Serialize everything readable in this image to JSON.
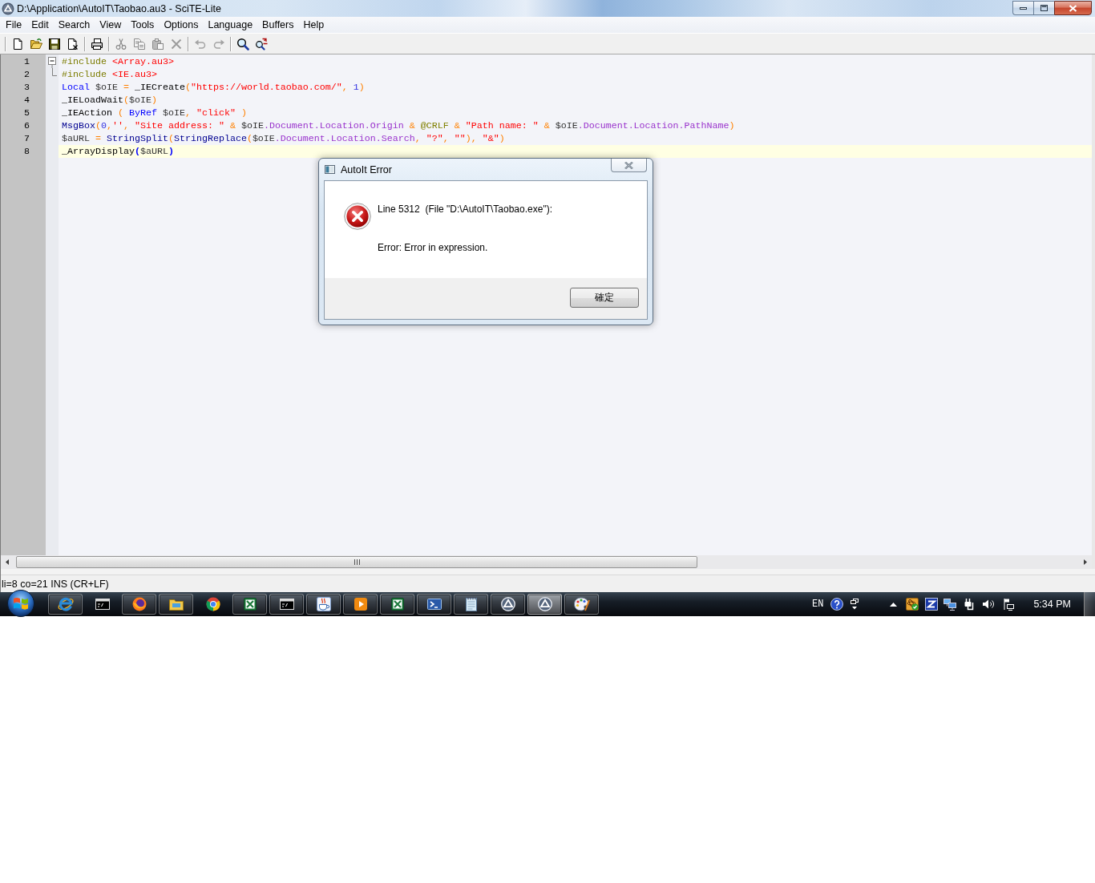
{
  "window": {
    "title": "D:\\Application\\AutoIT\\Taobao.au3 - SciTE-Lite"
  },
  "menu": [
    "File",
    "Edit",
    "Search",
    "View",
    "Tools",
    "Options",
    "Language",
    "Buffers",
    "Help"
  ],
  "toolbar": {
    "groups": [
      {
        "buttons": [
          {
            "kind": "new",
            "disabled": false
          },
          {
            "kind": "open",
            "disabled": false
          },
          {
            "kind": "save",
            "disabled": false
          },
          {
            "kind": "close",
            "disabled": false
          }
        ]
      },
      {
        "buttons": [
          {
            "kind": "print",
            "disabled": false
          }
        ]
      },
      {
        "buttons": [
          {
            "kind": "cut",
            "disabled": true
          },
          {
            "kind": "copy",
            "disabled": true
          },
          {
            "kind": "paste",
            "disabled": true
          },
          {
            "kind": "delete",
            "disabled": true
          }
        ]
      },
      {
        "buttons": [
          {
            "kind": "undo",
            "disabled": true
          },
          {
            "kind": "redo",
            "disabled": true
          }
        ]
      },
      {
        "buttons": [
          {
            "kind": "find",
            "disabled": false
          },
          {
            "kind": "replace",
            "disabled": false
          }
        ]
      }
    ]
  },
  "editor": {
    "lines": [
      {
        "number": "1",
        "kind": "fold_header",
        "current": false,
        "tokens": [
          {
            "kind": "directive",
            "text": "#include "
          },
          {
            "kind": "include",
            "text": "<Array.au3>"
          }
        ]
      },
      {
        "number": "2",
        "kind": "fold_end",
        "current": false,
        "tokens": [
          {
            "kind": "directive",
            "text": "#include "
          },
          {
            "kind": "include",
            "text": "<IE.au3>"
          }
        ]
      },
      {
        "number": "3",
        "kind": "plain",
        "current": false,
        "tokens": [
          {
            "kind": "keyword",
            "text": "Local "
          },
          {
            "kind": "variable",
            "text": "$oIE "
          },
          {
            "kind": "operator",
            "text": "= "
          },
          {
            "kind": "udf",
            "text": "_IECreate"
          },
          {
            "kind": "operator",
            "text": "("
          },
          {
            "kind": "string",
            "text": "\"https://world.taobao.com/\""
          },
          {
            "kind": "operator",
            "text": ", "
          },
          {
            "kind": "number",
            "text": "1"
          },
          {
            "kind": "operator",
            "text": ")"
          }
        ]
      },
      {
        "number": "4",
        "kind": "plain",
        "current": false,
        "tokens": [
          {
            "kind": "udf",
            "text": "_IELoadWait"
          },
          {
            "kind": "operator",
            "text": "("
          },
          {
            "kind": "variable",
            "text": "$oIE"
          },
          {
            "kind": "operator",
            "text": ")"
          }
        ]
      },
      {
        "number": "5",
        "kind": "plain",
        "current": false,
        "tokens": [
          {
            "kind": "udf",
            "text": "_IEAction "
          },
          {
            "kind": "operator",
            "text": "( "
          },
          {
            "kind": "keyword",
            "text": "ByRef "
          },
          {
            "kind": "variable",
            "text": "$oIE"
          },
          {
            "kind": "operator",
            "text": ", "
          },
          {
            "kind": "string",
            "text": "\"click\""
          },
          {
            "kind": "operator",
            "text": " )"
          }
        ]
      },
      {
        "number": "6",
        "kind": "plain",
        "current": false,
        "tokens": [
          {
            "kind": "function",
            "text": "MsgBox"
          },
          {
            "kind": "operator",
            "text": "("
          },
          {
            "kind": "number",
            "text": "0"
          },
          {
            "kind": "operator",
            "text": ","
          },
          {
            "kind": "string",
            "text": "''"
          },
          {
            "kind": "operator",
            "text": ", "
          },
          {
            "kind": "string",
            "text": "\"Site address: \""
          },
          {
            "kind": "operator",
            "text": " & "
          },
          {
            "kind": "variable",
            "text": "$oIE"
          },
          {
            "kind": "object",
            "text": ".Document.Location.Origin"
          },
          {
            "kind": "operator",
            "text": " & "
          },
          {
            "kind": "macro",
            "text": "@CRLF"
          },
          {
            "kind": "operator",
            "text": " & "
          },
          {
            "kind": "string",
            "text": "\"Path name: \""
          },
          {
            "kind": "operator",
            "text": " & "
          },
          {
            "kind": "variable",
            "text": "$oIE"
          },
          {
            "kind": "object",
            "text": ".Document.Location.PathName"
          },
          {
            "kind": "operator",
            "text": ")"
          }
        ]
      },
      {
        "number": "7",
        "kind": "plain",
        "current": false,
        "tokens": [
          {
            "kind": "variable",
            "text": "$aURL "
          },
          {
            "kind": "operator",
            "text": "= "
          },
          {
            "kind": "function",
            "text": "StringSplit"
          },
          {
            "kind": "operator",
            "text": "("
          },
          {
            "kind": "function",
            "text": "StringReplace"
          },
          {
            "kind": "operator",
            "text": "("
          },
          {
            "kind": "variable",
            "text": "$oIE"
          },
          {
            "kind": "object",
            "text": ".Document.Location.Search"
          },
          {
            "kind": "operator",
            "text": ", "
          },
          {
            "kind": "string",
            "text": "\"?\""
          },
          {
            "kind": "operator",
            "text": ", "
          },
          {
            "kind": "string",
            "text": "\"\""
          },
          {
            "kind": "operator",
            "text": "), "
          },
          {
            "kind": "string",
            "text": "\"&\""
          },
          {
            "kind": "operator",
            "text": ")"
          }
        ]
      },
      {
        "number": "8",
        "kind": "plain",
        "current": true,
        "tokens": [
          {
            "kind": "udf",
            "text": "_ArrayDisplay"
          },
          {
            "kind": "brace",
            "text": "("
          },
          {
            "kind": "variable",
            "text": "$aURL"
          },
          {
            "kind": "brace",
            "text": ")"
          }
        ]
      }
    ]
  },
  "dialog": {
    "title": "AutoIt Error",
    "message": [
      "Line 5312  (File \"D:\\AutoIT\\Taobao.exe\"):",
      "Error: Error in expression."
    ],
    "buttons": [
      "確定"
    ]
  },
  "status_bar": {
    "text": "li=8 co=21 INS (CR+LF)"
  },
  "taskbar": {
    "apps": [
      {
        "kind": "ie",
        "running": true,
        "selected": false
      },
      {
        "kind": "cmd",
        "running": false,
        "selected": false
      },
      {
        "kind": "firefox",
        "running": true,
        "selected": false
      },
      {
        "kind": "explorer",
        "running": true,
        "selected": false
      },
      {
        "kind": "chrome",
        "running": false,
        "selected": false
      },
      {
        "kind": "excel",
        "running": true,
        "selected": false
      },
      {
        "kind": "cmd",
        "running": true,
        "selected": false
      },
      {
        "kind": "java",
        "running": true,
        "selected": false
      },
      {
        "kind": "media",
        "running": true,
        "selected": false
      },
      {
        "kind": "excel",
        "running": true,
        "selected": false
      },
      {
        "kind": "powershell",
        "running": true,
        "selected": false
      },
      {
        "kind": "notepad",
        "running": true,
        "selected": false
      },
      {
        "kind": "autoit",
        "running": true,
        "selected": false
      },
      {
        "kind": "autoit",
        "running": true,
        "selected": true
      },
      {
        "kind": "paint",
        "running": true,
        "selected": false
      }
    ],
    "language": "EN",
    "clock": "5:34 PM"
  }
}
